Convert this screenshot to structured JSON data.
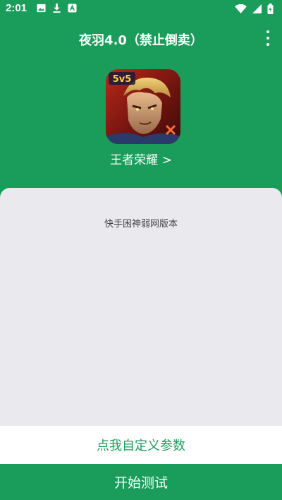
{
  "status_bar": {
    "time": "2:01",
    "left_icons": [
      "image-icon",
      "download-icon",
      "app-notification-icon"
    ],
    "right_icons": [
      "wifi-icon",
      "signal-icon",
      "battery-icon"
    ]
  },
  "app_bar": {
    "title": "夜羽4.0（禁止倒卖）",
    "menu_icon": "more-vert-icon"
  },
  "game": {
    "icon_badge": "5v5",
    "name": "王者荣耀 >"
  },
  "panel": {
    "version_label": "快手困神弱网版本"
  },
  "actions": {
    "custom_params_label": "点我自定义参数",
    "start_label": "开始测试"
  },
  "colors": {
    "primary": "#1a9c5a",
    "panel_bg": "#e9e9ee",
    "white": "#ffffff"
  }
}
